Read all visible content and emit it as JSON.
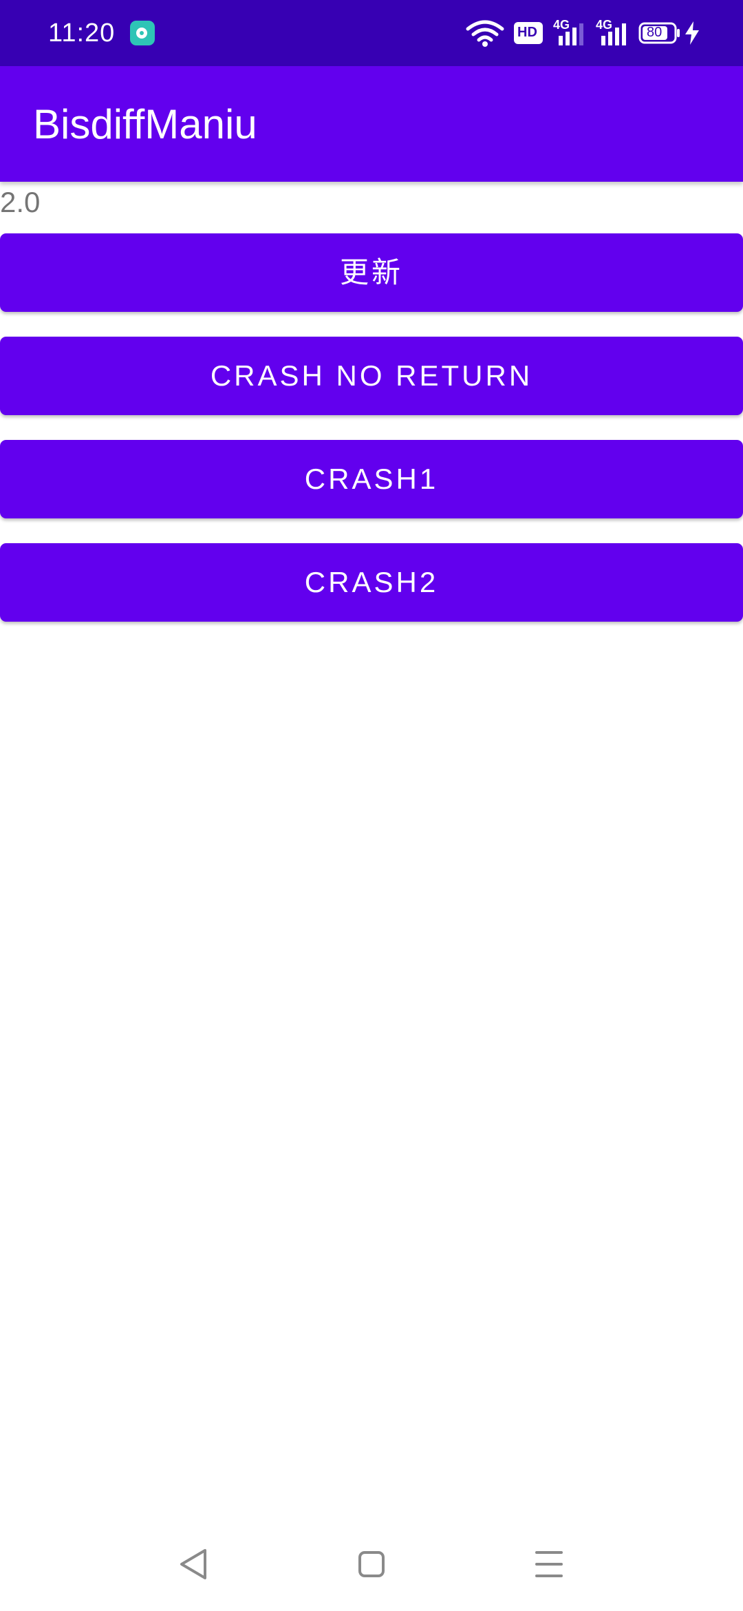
{
  "status_bar": {
    "time": "11:20",
    "battery_level": "80",
    "hd_label": "HD",
    "network_1": "4G",
    "network_2": "4G",
    "icons": [
      "notification-app-icon",
      "wifi-icon",
      "hd-voice-icon",
      "signal-4g-icon",
      "signal-4g-icon",
      "battery-icon",
      "charging-icon"
    ],
    "background_color": "#3700B3"
  },
  "app_bar": {
    "title": "BisdiffManiu",
    "background_color": "#6200EE"
  },
  "main": {
    "version": "2.0",
    "buttons": [
      {
        "label": "更新"
      },
      {
        "label": "CRASH NO RETURN"
      },
      {
        "label": "CRASH1"
      },
      {
        "label": "CRASH2"
      }
    ],
    "button_color": "#6200EE"
  },
  "nav_bar": {
    "icons": [
      "back-icon",
      "home-icon",
      "recents-icon"
    ]
  }
}
